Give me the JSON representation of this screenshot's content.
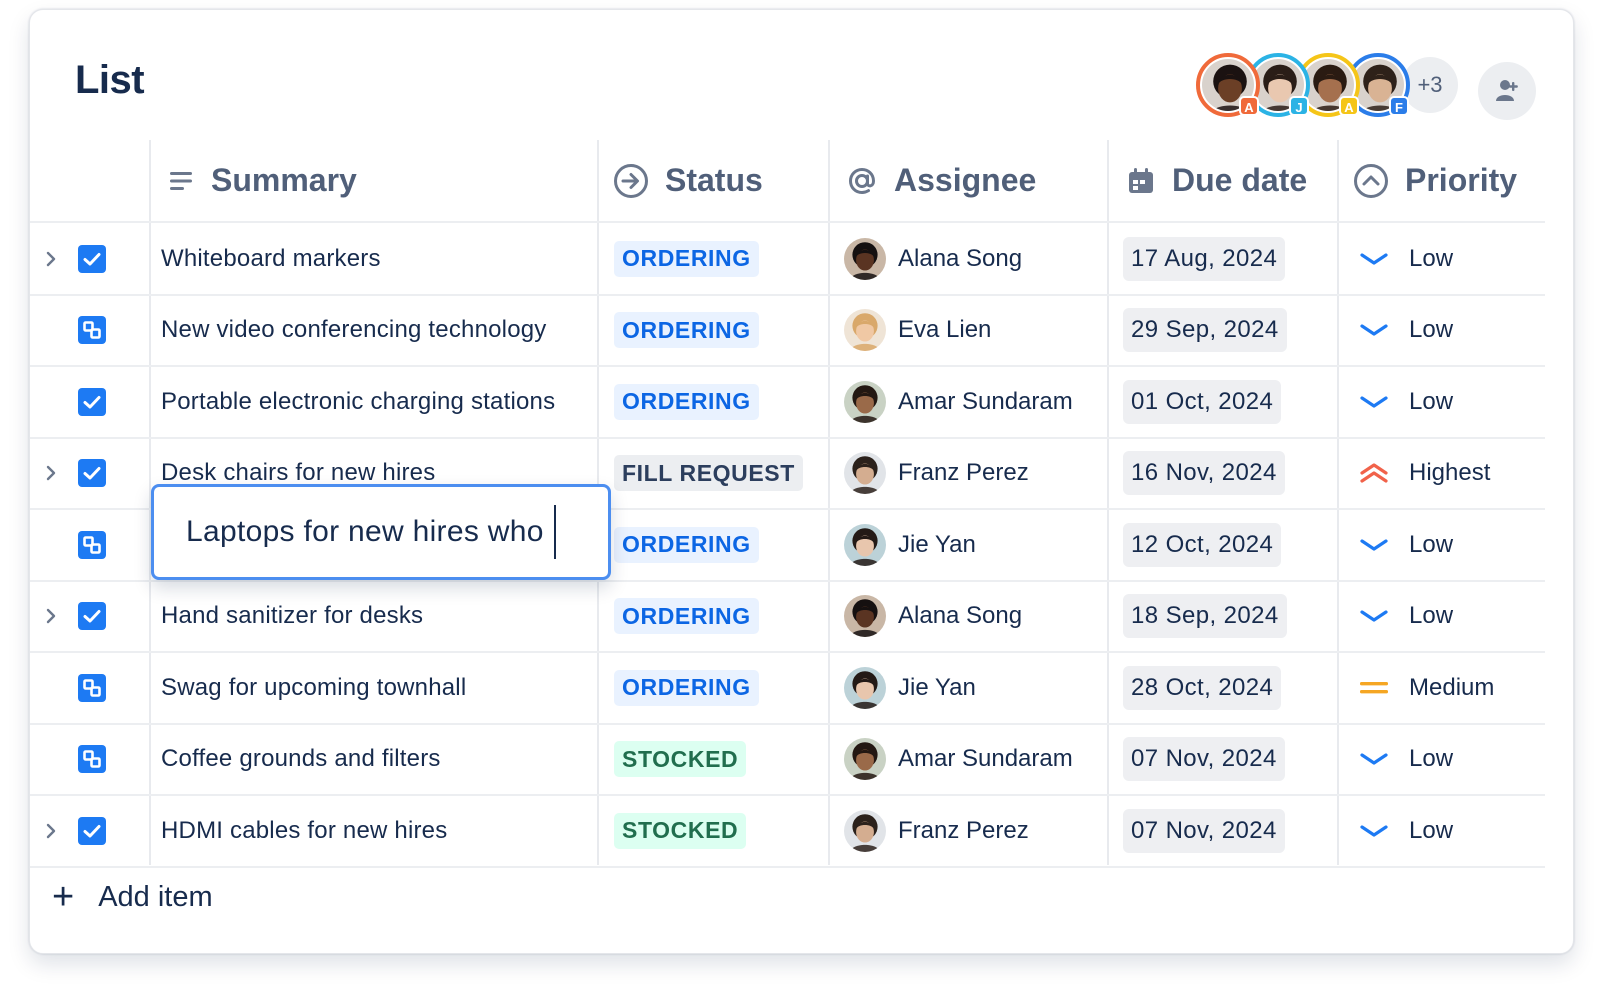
{
  "app": {
    "title": "List",
    "add_item_label": "Add item",
    "more_collaborators": "+3"
  },
  "collaborators": [
    {
      "initial": "A",
      "ring": "#f06a3a",
      "badge": "#f06a3a",
      "skin": "#6b3f26",
      "hair": "#1b1211"
    },
    {
      "initial": "J",
      "ring": "#2bb3e5",
      "badge": "#2bb3e5",
      "skin": "#e9c8b0",
      "hair": "#2a1d17"
    },
    {
      "initial": "A",
      "ring": "#f5c518",
      "badge": "#f5c518",
      "skin": "#a5704e",
      "hair": "#2a1b12"
    },
    {
      "initial": "F",
      "ring": "#2b7de9",
      "badge": "#2b7de9",
      "skin": "#d9b394",
      "hair": "#2e2119"
    }
  ],
  "columns": {
    "summary": "Summary",
    "status": "Status",
    "assignee": "Assignee",
    "due_date": "Due date",
    "priority": "Priority"
  },
  "colors": {
    "check_blue": "#1d7af3",
    "ordering_bg": "#e9f2ff",
    "ordering_fg": "#0c66e4",
    "fill_bg": "#eceef1",
    "fill_fg": "#2c3e5d",
    "stocked_bg": "#dcfff1",
    "stocked_fg": "#216e4e",
    "low": "#1d7af3",
    "medium": "#f5a623",
    "highest": "#f1624a"
  },
  "rows": [
    {
      "summary": "Whiteboard markers",
      "expandable": true,
      "type": "task",
      "status": "ORDERING",
      "status_kind": "ordering",
      "assignee": "Alana Song",
      "avatar": "alana",
      "due": "17 Aug, 2024",
      "priority": "Low",
      "priority_kind": "low"
    },
    {
      "summary": "New video conferencing technology",
      "expandable": false,
      "type": "subtask",
      "status": "ORDERING",
      "status_kind": "ordering",
      "assignee": "Eva Lien",
      "avatar": "eva",
      "due": "29 Sep, 2024",
      "priority": "Low",
      "priority_kind": "low"
    },
    {
      "summary": "Portable electronic charging stations",
      "expandable": false,
      "type": "task",
      "status": "ORDERING",
      "status_kind": "ordering",
      "assignee": "Amar Sundaram",
      "avatar": "amar",
      "due": "01 Oct, 2024",
      "priority": "Low",
      "priority_kind": "low"
    },
    {
      "summary": "Desk chairs for new hires",
      "expandable": true,
      "type": "task",
      "status": "FILL REQUEST",
      "status_kind": "fill",
      "assignee": "Franz Perez",
      "avatar": "franz",
      "due": "16 Nov, 2024",
      "priority": "Highest",
      "priority_kind": "highest"
    },
    {
      "summary": "",
      "expandable": false,
      "type": "subtask",
      "status": "ORDERING",
      "status_kind": "ordering",
      "assignee": "Jie Yan",
      "avatar": "jie",
      "due": "12 Oct, 2024",
      "priority": "Low",
      "priority_kind": "low"
    },
    {
      "summary": "Hand sanitizer for desks",
      "expandable": true,
      "type": "task",
      "status": "ORDERING",
      "status_kind": "ordering",
      "assignee": "Alana Song",
      "avatar": "alana",
      "due": "18 Sep, 2024",
      "priority": "Low",
      "priority_kind": "low"
    },
    {
      "summary": "Swag for upcoming townhall",
      "expandable": false,
      "type": "subtask",
      "status": "ORDERING",
      "status_kind": "ordering",
      "assignee": "Jie Yan",
      "avatar": "jie",
      "due": "28 Oct, 2024",
      "priority": "Medium",
      "priority_kind": "medium"
    },
    {
      "summary": "Coffee grounds and filters",
      "expandable": false,
      "type": "subtask",
      "status": "STOCKED",
      "status_kind": "stocked",
      "assignee": "Amar Sundaram",
      "avatar": "amar",
      "due": "07 Nov, 2024",
      "priority": "Low",
      "priority_kind": "low"
    },
    {
      "summary": "HDMI cables for new hires",
      "expandable": true,
      "type": "task",
      "status": "STOCKED",
      "status_kind": "stocked",
      "assignee": "Franz Perez",
      "avatar": "franz",
      "due": "07 Nov, 2024",
      "priority": "Low",
      "priority_kind": "low"
    }
  ],
  "people": {
    "alana": {
      "skin": "#5a3422",
      "hair": "#151010",
      "bg": "#c9b7a6"
    },
    "eva": {
      "skin": "#f0c8a4",
      "hair": "#d9a86a",
      "bg": "#efe4d6"
    },
    "amar": {
      "skin": "#9a6a49",
      "hair": "#231812",
      "bg": "#c9d2c4"
    },
    "franz": {
      "skin": "#d4ad90",
      "hair": "#2b211b",
      "bg": "#e1e4e8"
    },
    "jie": {
      "skin": "#e8c6ad",
      "hair": "#231a16",
      "bg": "#bcd2d8"
    }
  },
  "inline_editor": {
    "value": "Laptops for new hires who"
  }
}
